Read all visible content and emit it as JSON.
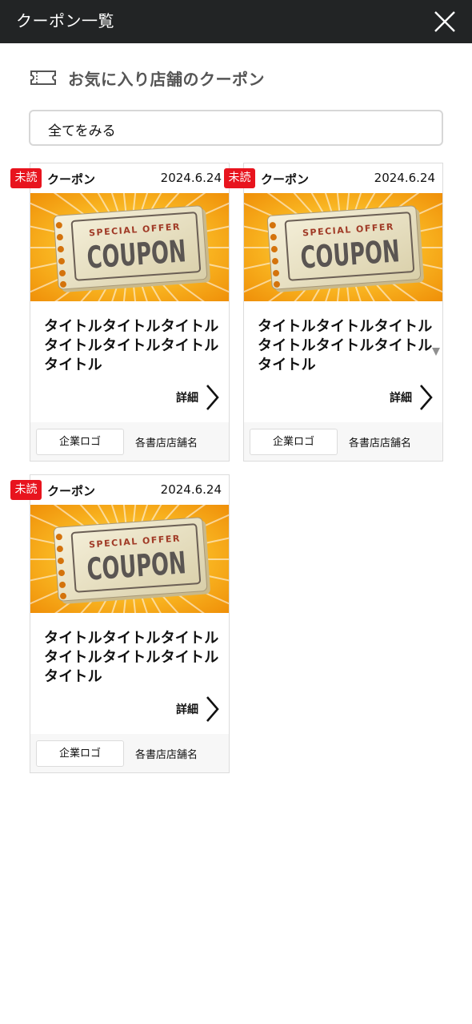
{
  "header": {
    "title": "クーポン一覧"
  },
  "section": {
    "title": "お気に入り店舗のクーポン"
  },
  "view_all": {
    "label": "全てをみる"
  },
  "coupons": [
    {
      "badge": "未読",
      "type": "クーポン",
      "date": "2024.6.24",
      "image_text": {
        "top": "SPECIAL OFFER",
        "main": "COUPON"
      },
      "title": [
        "タイトルタイトルタイトル",
        "タイトルタイトルタイトル",
        "タイトル"
      ],
      "detail": "詳細",
      "logo": "企業ロゴ",
      "shop": "各書店店舗名"
    },
    {
      "badge": "未読",
      "type": "クーポン",
      "date": "2024.6.24",
      "image_text": {
        "top": "SPECIAL OFFER",
        "main": "COUPON"
      },
      "title": [
        "タイトルタイトルタイトル",
        "タイトルタイトルタイトル",
        "タイトル"
      ],
      "detail": "詳細",
      "logo": "企業ロゴ",
      "shop": "各書店店舗名"
    },
    {
      "badge": "未読",
      "type": "クーポン",
      "date": "2024.6.24",
      "image_text": {
        "top": "SPECIAL OFFER",
        "main": "COUPON"
      },
      "title": [
        "タイトルタイトルタイトル",
        "タイトルタイトルタイトル",
        "タイトル"
      ],
      "detail": "詳細",
      "logo": "企業ロゴ",
      "shop": "各書店店舗名"
    }
  ],
  "colors": {
    "topbar": "#222425",
    "badge": "#e8141e",
    "image_orange": "#f39a0a"
  },
  "icons": {
    "close": "close-icon",
    "ticket": "ticket-icon",
    "detail_arrow": "chevron-right-icon"
  }
}
